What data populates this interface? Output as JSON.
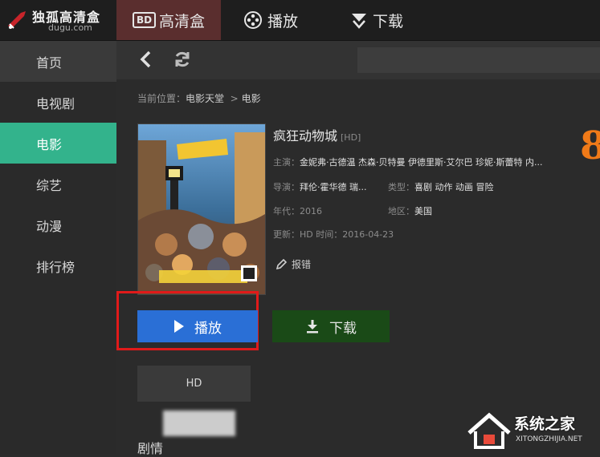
{
  "app": {
    "name": "独孤高清盒",
    "domain": "dugu.com"
  },
  "topnav": [
    {
      "badge": "BD",
      "label": "高清盒",
      "icon": "bd-badge-icon"
    },
    {
      "label": "播放",
      "icon": "film-reel-icon"
    },
    {
      "label": "下载",
      "icon": "download-arrow-icon"
    }
  ],
  "sidebar": {
    "items": [
      {
        "label": "首页"
      },
      {
        "label": "电视剧"
      },
      {
        "label": "电影"
      },
      {
        "label": "综艺"
      },
      {
        "label": "动漫"
      },
      {
        "label": "排行榜"
      }
    ],
    "active_index": 2
  },
  "breadcrumb": {
    "prefix": "当前位置：",
    "level1": "电影天堂",
    "sep": ">",
    "level2": "电影"
  },
  "movie": {
    "title": "疯狂动物城",
    "quality_tag": "[HD]",
    "cast_label": "主演：",
    "cast_value": "金妮弗·古德温 杰森·贝特曼 伊德里斯·艾尔巴 珍妮·斯蕾特 内...",
    "director_label": "导演：",
    "director_value": "拜伦·霍华德 瑞...",
    "genre_label": "类型：",
    "genre_value": "喜剧 动作 动画 冒险",
    "year_label": "年代：",
    "year_value": "2016",
    "region_label": "地区：",
    "region_value": "美国",
    "update_label": "更新：",
    "update_value": "HD 时间：2016-04-23",
    "score_partial": "8",
    "report_label": "报错"
  },
  "actions": {
    "play_label": "播放",
    "download_label": "下载"
  },
  "quality_option": "HD",
  "episode_section_title": "剧情",
  "watermark": {
    "title": "系统之家",
    "sub": "XITONGZHIJIA.NET"
  },
  "colors": {
    "accent_green": "#33b38c",
    "play_blue": "#2a6fd6",
    "download_green": "#1a4a17",
    "highlight_red": "#e01a1a",
    "score_orange": "#f07a18"
  }
}
